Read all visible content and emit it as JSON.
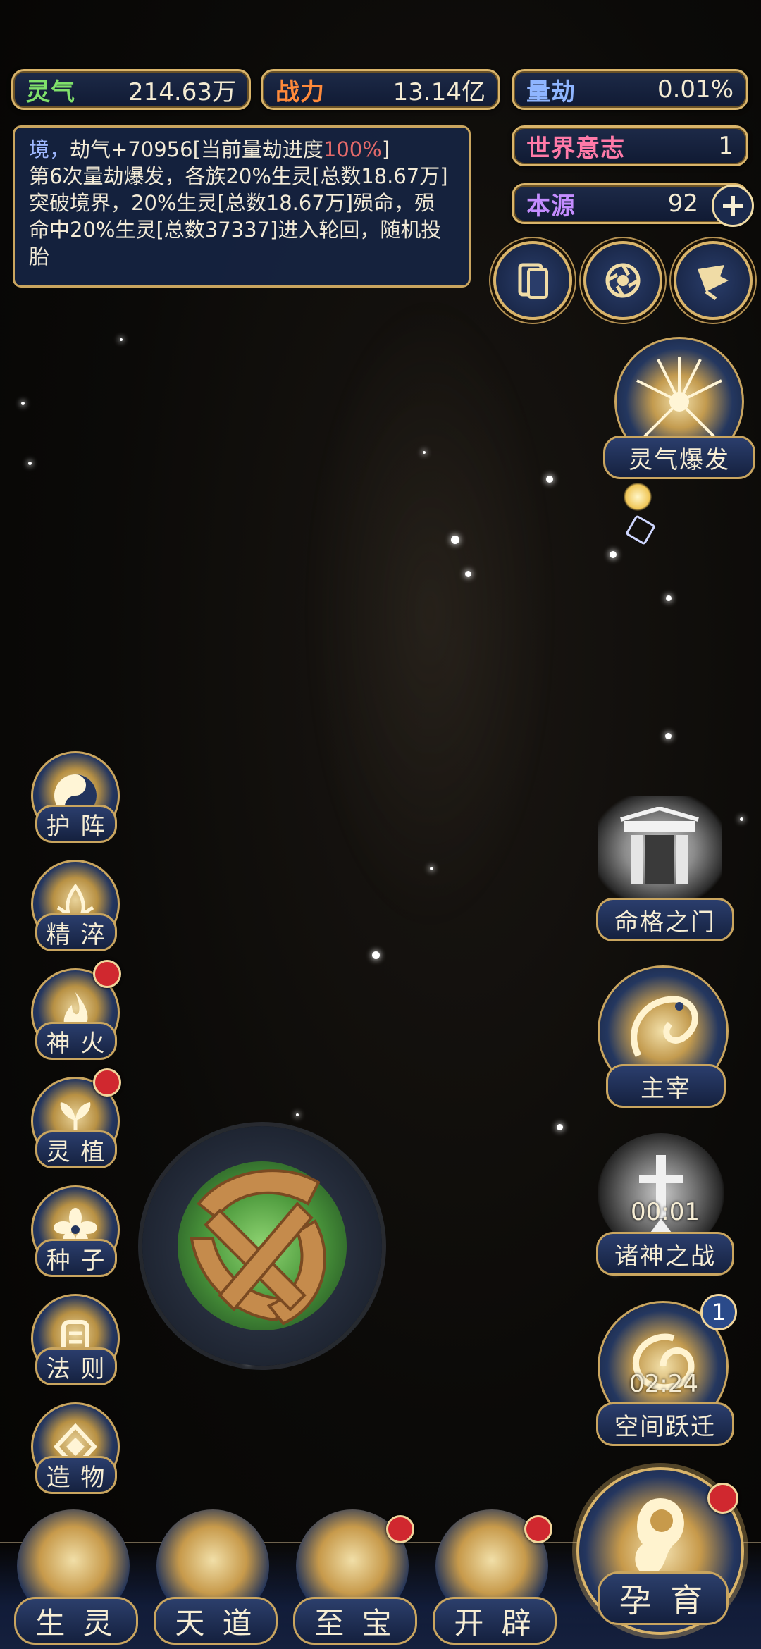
{
  "top_stats": {
    "lingqi": {
      "label": "灵气",
      "value": "214.63万"
    },
    "zhanli": {
      "label": "战力",
      "value": "13.14亿"
    },
    "liangjie": {
      "label": "量劫",
      "value": "0.01%"
    },
    "world_will": {
      "label": "世界意志",
      "value": "1"
    },
    "benyuan": {
      "label": "本源",
      "value": "92"
    }
  },
  "info_log": {
    "line1_prefix": "境，",
    "line1_main": "劫气+70956[当前量劫进度",
    "line1_pct": "100%",
    "line1_suffix": "]",
    "body": "第6次量劫爆发，各族20%生灵[总数18.67万]突破境界，20%生灵[总数18.67万]殒命，殒命中20%生灵[总数37337]进入轮回，随机投胎"
  },
  "right_actions": {
    "lingqi_burst": "灵气爆发",
    "mingge_gate": "命格之门",
    "zhuzai": "主宰",
    "zhushen_war": "诸神之战",
    "zhushen_timer": "00:01",
    "space_jump": "空间跃迁",
    "space_timer": "02:24",
    "space_badge": "1"
  },
  "left_menu": [
    {
      "label": "护 阵",
      "badge": false
    },
    {
      "label": "精 淬",
      "badge": false
    },
    {
      "label": "神 火",
      "badge": true
    },
    {
      "label": "灵 植",
      "badge": true
    },
    {
      "label": "种 子",
      "badge": false
    },
    {
      "label": "法 则",
      "badge": false
    },
    {
      "label": "造 物",
      "badge": false
    }
  ],
  "bottom_nav": [
    {
      "label": "生 灵",
      "badge": false
    },
    {
      "label": "天 道",
      "badge": false
    },
    {
      "label": "至 宝",
      "badge": true
    },
    {
      "label": "开 辟",
      "badge": true
    },
    {
      "label": "孕 育",
      "badge": true
    }
  ],
  "colors": {
    "gold": "#d9b46a",
    "panel_blue": "#1d2a48",
    "badge_red": "#d0282f",
    "lingqi_label": "#7fe06a",
    "zhanli_label": "#ff8a3a",
    "liangjie_label": "#8fb5ff",
    "world_label": "#ff7aa8",
    "benyuan_label": "#c48dff"
  }
}
